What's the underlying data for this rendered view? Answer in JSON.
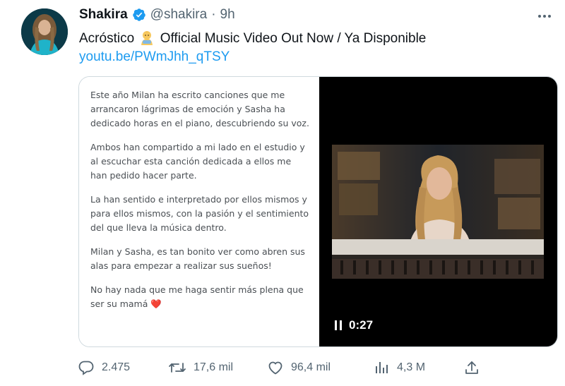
{
  "author": {
    "display_name": "Shakira",
    "handle": "@shakira",
    "separator": "·",
    "time": "9h",
    "verified": true
  },
  "tweet": {
    "text_before_emoji": "Acróstico",
    "emoji": "baby-emoji",
    "text_after_emoji": "Official Music Video Out Now / Ya Disponible",
    "link": "youtu.be/PWmJhh_qTSY"
  },
  "media": {
    "letter_paragraphs": [
      "Este año Milan ha escrito canciones que me arrancaron lágrimas de emoción y Sasha ha dedicado horas en el piano, descubriendo su voz.",
      "Ambos han compartido a mi lado en el estudio y al escuchar esta canción dedicada a ellos me han pedido hacer parte.",
      "La han sentido e interpretado por ellos mismos y para ellos mismos, con la pasión y el sentimiento del que lleva la música dentro.",
      "Milan y Sasha, es tan bonito ver como abren sus alas para empezar a realizar sus sueños!",
      "No hay nada que me haga sentir más plena que ser su mamá"
    ],
    "letter_emoji": "❤️",
    "video_time": "0:27",
    "video_state": "playing"
  },
  "actions": {
    "replies": "2.475",
    "retweets": "17,6 mil",
    "likes": "96,4 mil",
    "views": "4,3 M"
  },
  "colors": {
    "link": "#1d9bf0",
    "secondary_text": "#536471",
    "verified_badge": "#1d9bf0",
    "heart": "#d61f2a"
  }
}
